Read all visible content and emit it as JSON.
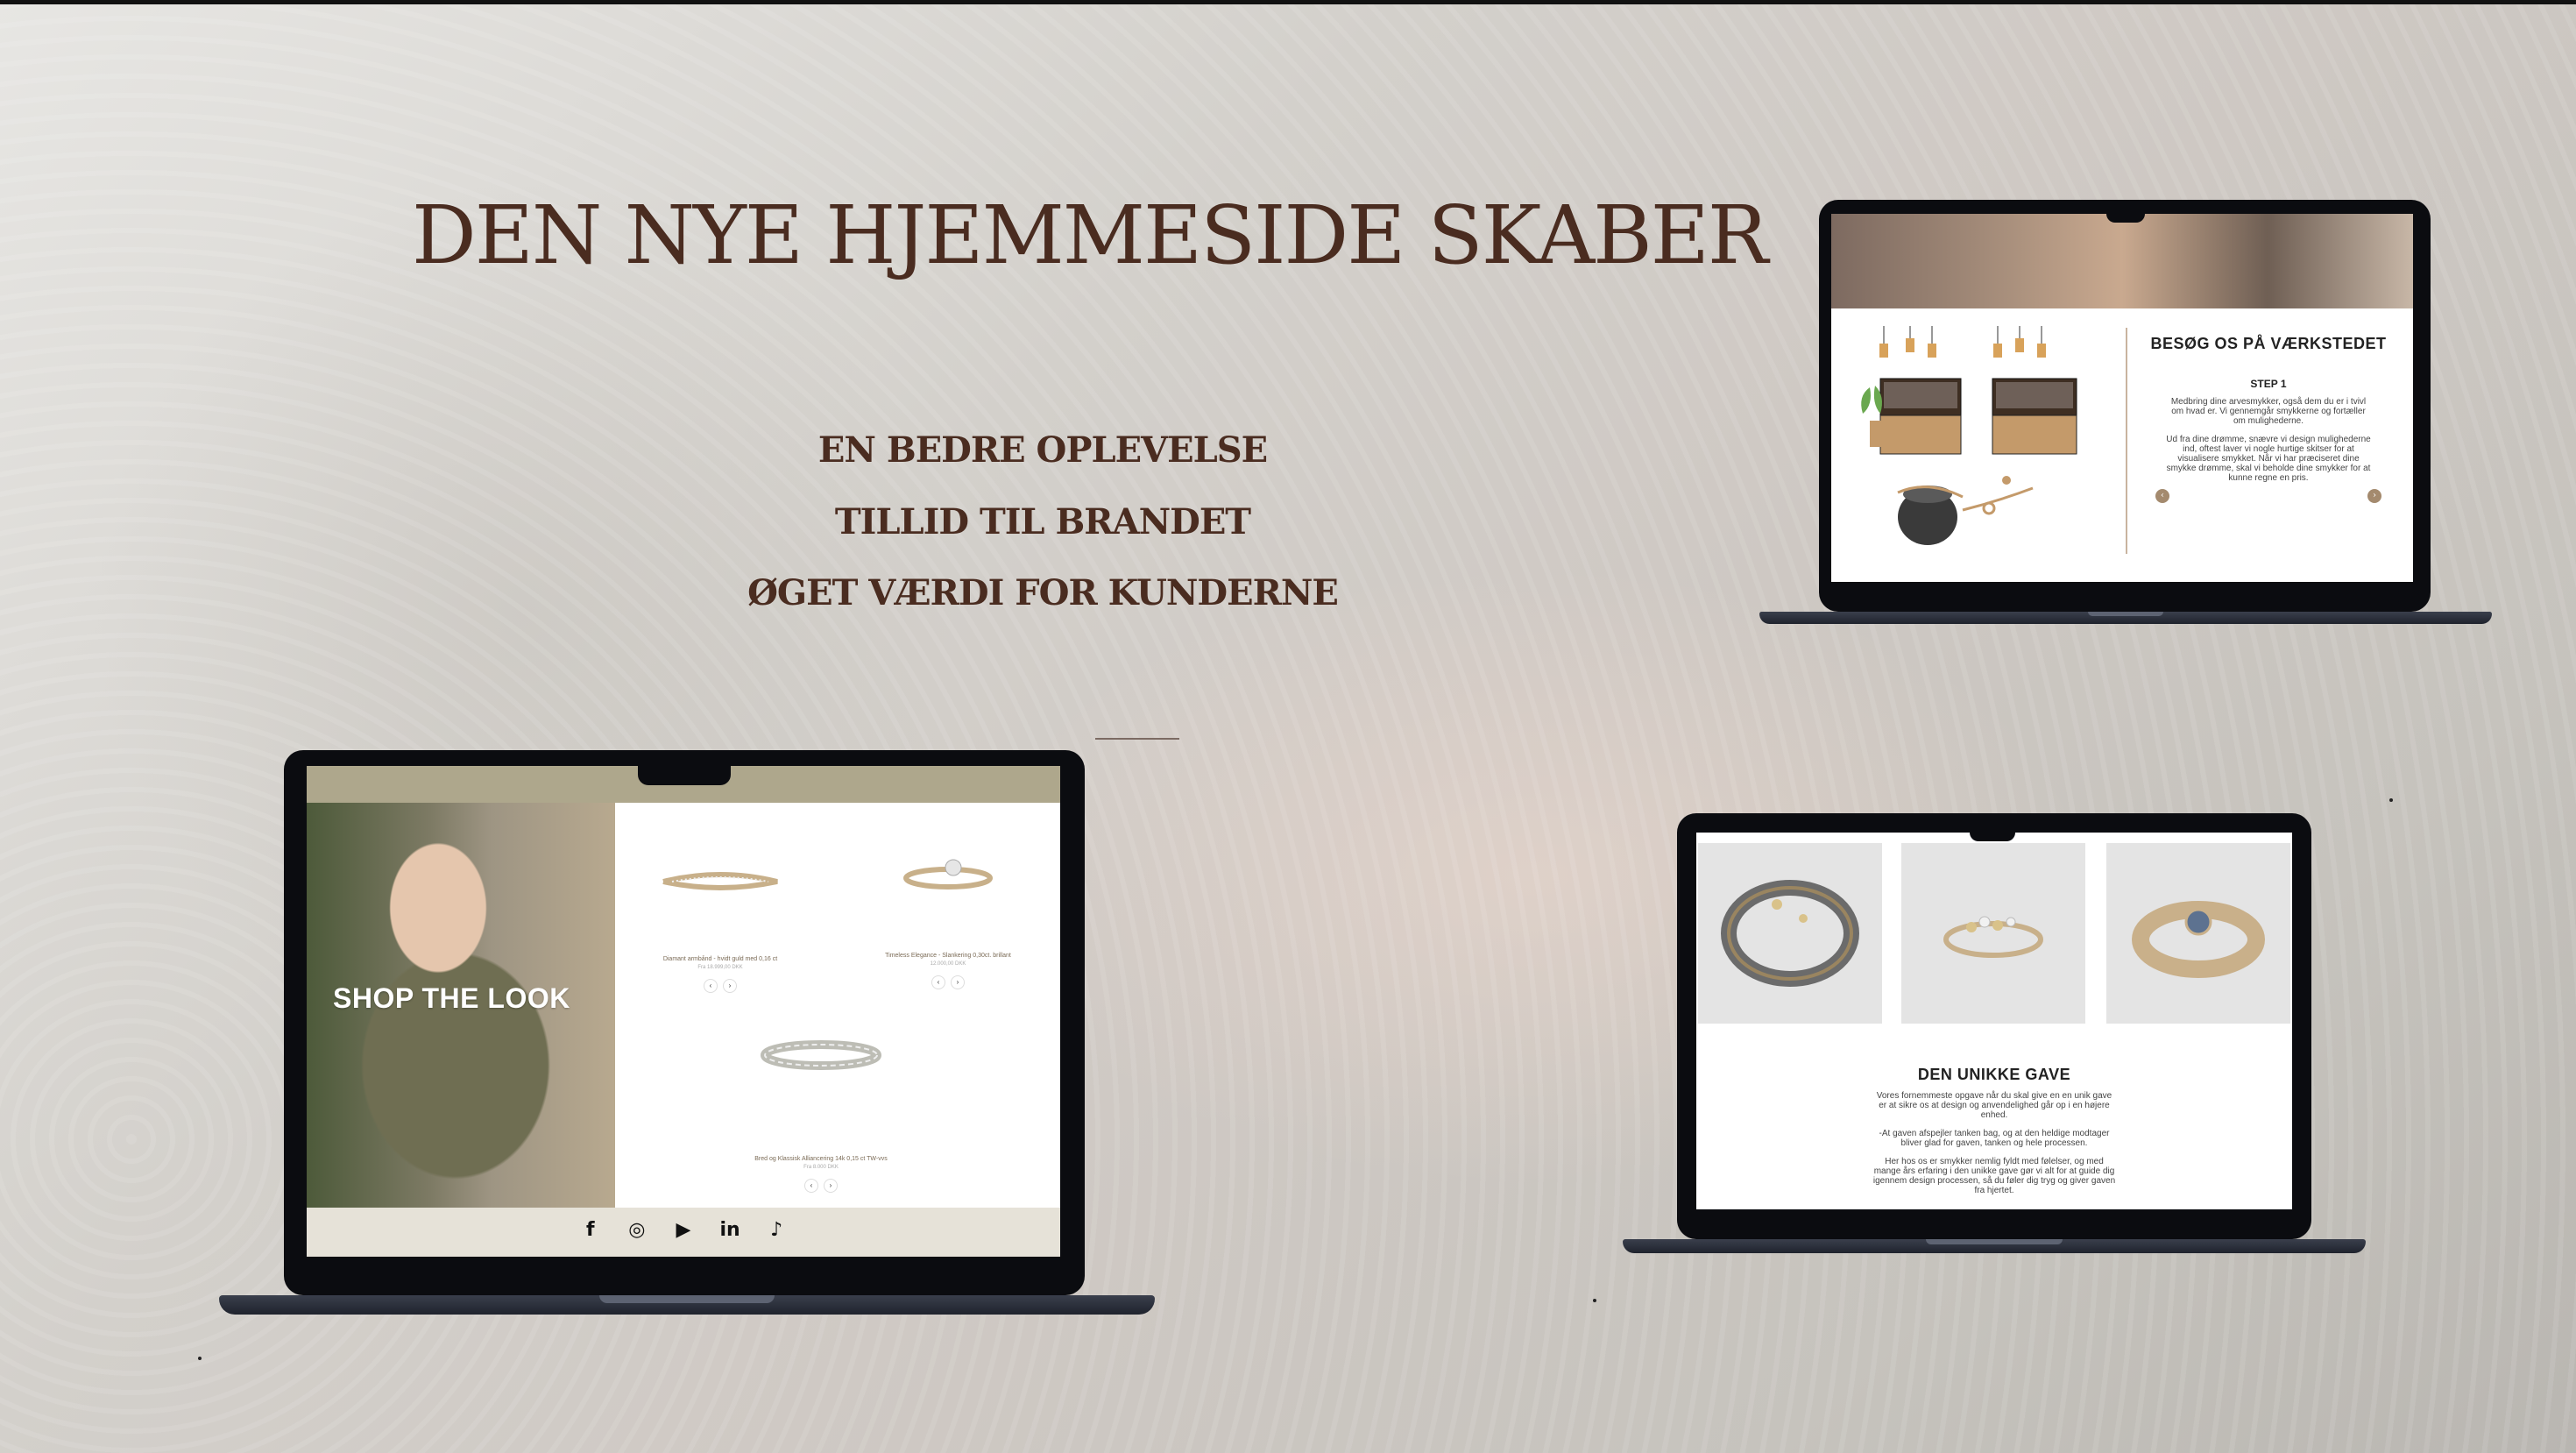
{
  "title": "DEN NYE HJEMMESIDE SKABER",
  "taglines": [
    "EN BEDRE OPLEVELSE",
    "TILLID TIL BRANDET",
    "ØGET VÆRDI FOR KUNDERNE"
  ],
  "laptop_workshop": {
    "heading": "BESØG OS PÅ VÆRKSTEDET",
    "step": "STEP 1",
    "paragraph1": "Medbring dine arvesmykker, også dem du er i tvivl om hvad er. Vi gennemgår smykkerne og fortæller om mulighederne.",
    "paragraph2": "Ud fra dine drømme, snævre vi design mulighederne ind, oftest laver vi nogle hurtige skitser for at visualisere smykket. Når vi har præciseret dine smykke drømme, skal vi beholde dine smykker for at kunne regne en pris.",
    "prev": "‹",
    "next": "›"
  },
  "laptop_shop": {
    "photo_label": "SHOP THE LOOK",
    "products": [
      {
        "name": "Diamant armbånd - hvidt guld med 0,16 ct",
        "price": "Fra 18.999,00 DKK"
      },
      {
        "name": "Timeless Elegance - Slankering 0,30ct. brillant",
        "price": "12.000,00 DKK"
      },
      {
        "name": "Bred og Klassisk Alliancering 14k 0,15 ct TW-vvs",
        "price": "Fra 8.000 DKK"
      }
    ],
    "arrow_prev": "‹",
    "arrow_next": "›",
    "social_icons": [
      "facebook-icon",
      "instagram-icon",
      "youtube-icon",
      "linkedin-icon",
      "tiktok-icon"
    ],
    "social_glyphs": [
      "f",
      "◎",
      "▶",
      "in",
      "♪"
    ]
  },
  "laptop_gift": {
    "heading": "DEN UNIKKE GAVE",
    "paragraph1": "Vores fornemmeste opgave når du skal give en en unik gave er at sikre os at design og anvendelighed går op i en højere enhed.",
    "paragraph2": "-At gaven afspejler tanken bag, og at den heldige modtager bliver glad for gaven, tanken og hele processen.",
    "paragraph3": "Her hos os er smykker nemlig fyldt med følelser, og med mange års erfaring i den unikke gave gør vi alt for at guide dig igennem design processen, så du føler dig tryg og giver gaven fra hjertet."
  },
  "colors": {
    "title": "#4a2c20",
    "accent_olive": "#aea78c",
    "accent_tan": "#a48a6e"
  }
}
